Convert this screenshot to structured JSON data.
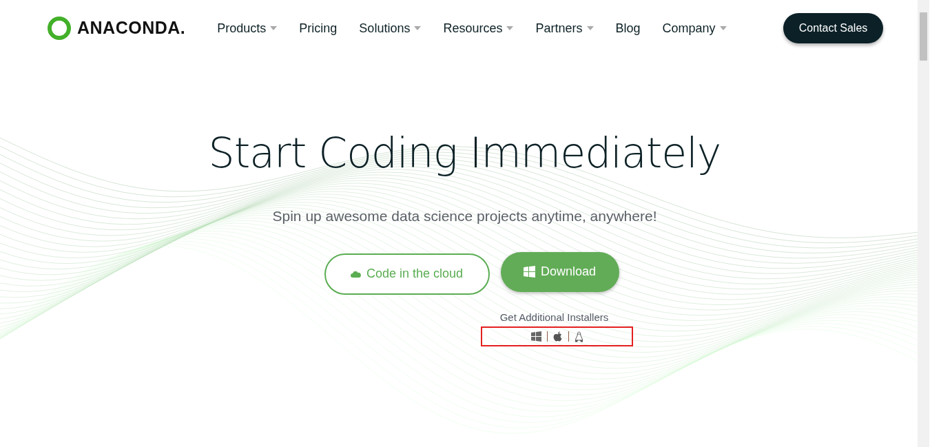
{
  "logo": {
    "text": "ANACONDA."
  },
  "nav": [
    {
      "label": "Products",
      "dropdown": true
    },
    {
      "label": "Pricing",
      "dropdown": false
    },
    {
      "label": "Solutions",
      "dropdown": true
    },
    {
      "label": "Resources",
      "dropdown": true
    },
    {
      "label": "Partners",
      "dropdown": true
    },
    {
      "label": "Blog",
      "dropdown": false
    },
    {
      "label": "Company",
      "dropdown": true
    }
  ],
  "contact_button": {
    "label": "Contact Sales"
  },
  "hero": {
    "title": "Start Coding Immediately",
    "subtitle": "Spin up awesome data science projects anytime, anywhere!",
    "buttons": [
      {
        "label": "Code in the cloud",
        "kind": "outline"
      },
      {
        "label": "Download",
        "kind": "solid"
      }
    ],
    "installers_label": "Get Additional Installers"
  }
}
